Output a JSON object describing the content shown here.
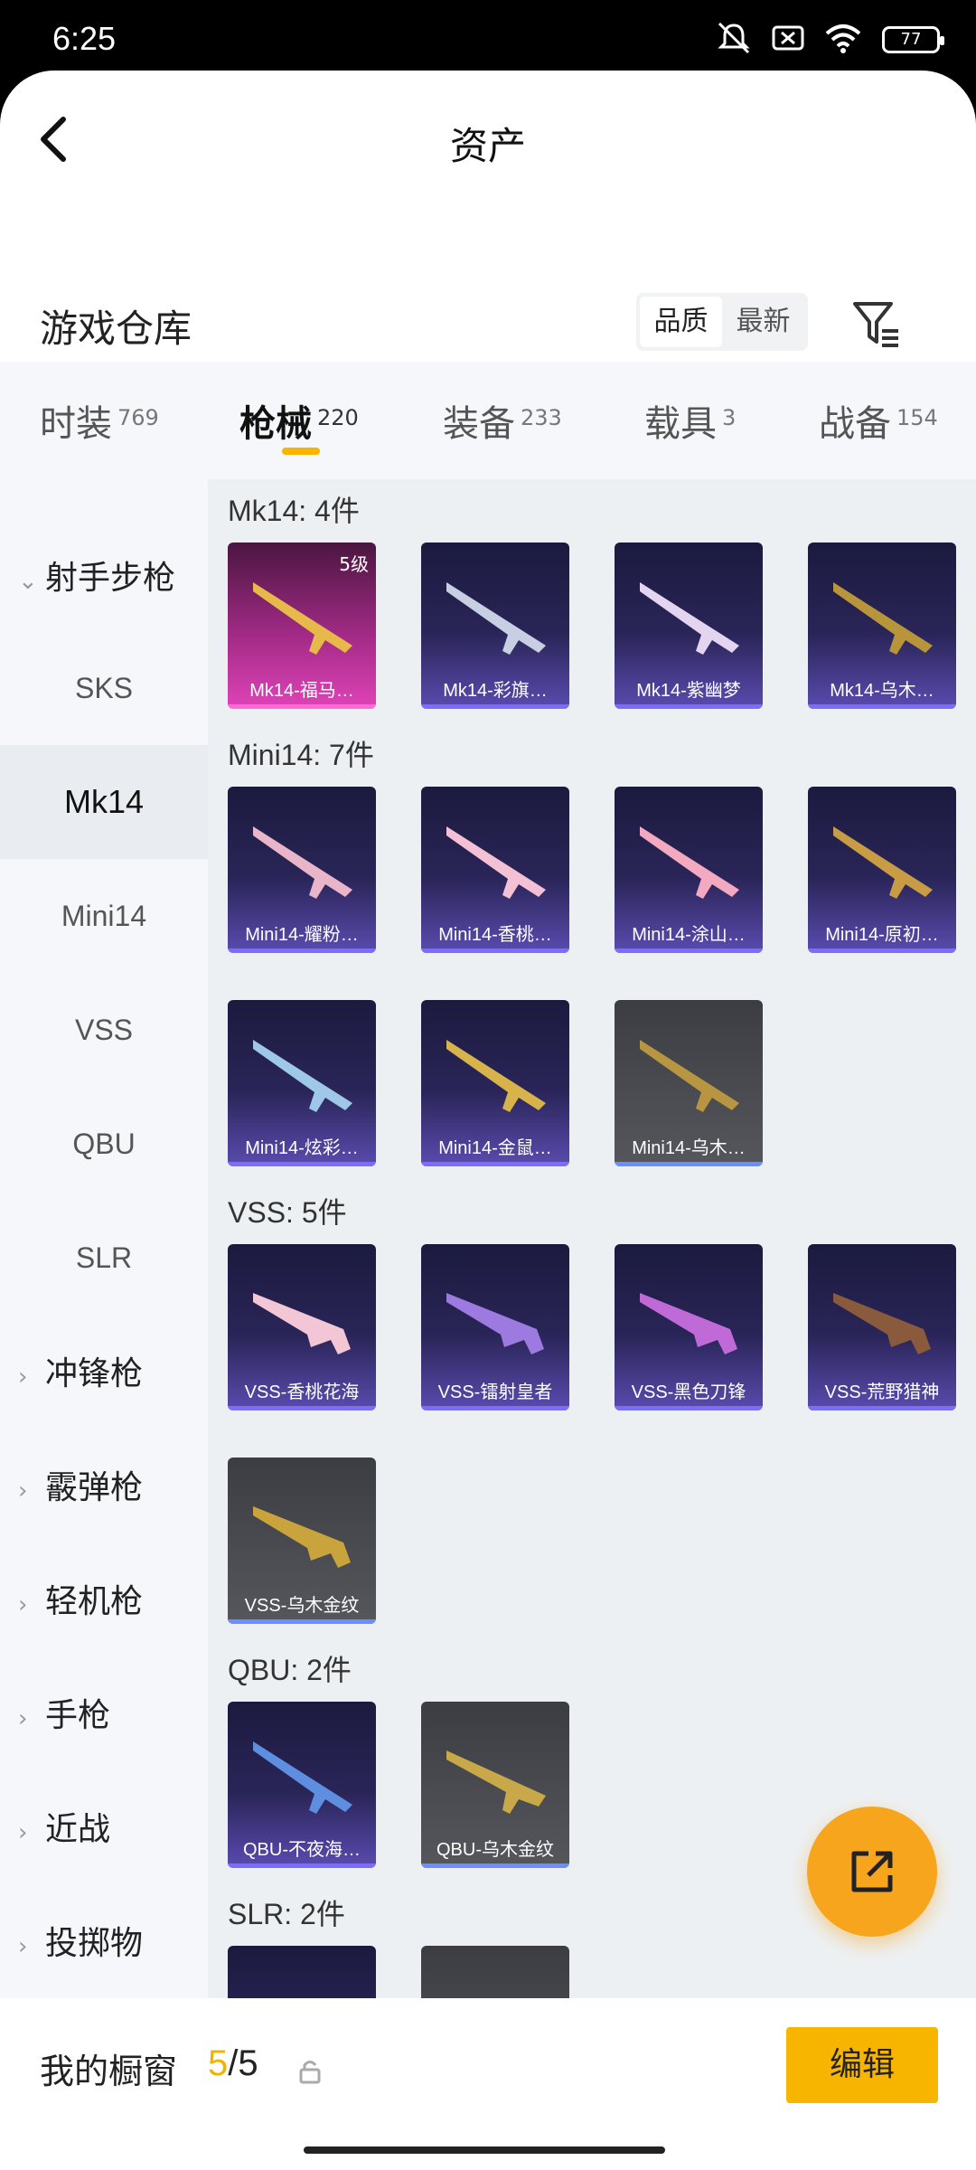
{
  "status": {
    "time": "6:25",
    "battery": "77"
  },
  "nav": {
    "title": "资产"
  },
  "warehouse": {
    "title": "游戏仓库",
    "sort_quality": "品质",
    "sort_newest": "最新"
  },
  "tabs": [
    {
      "label": "时装",
      "count": "769"
    },
    {
      "label": "枪械",
      "count": "220"
    },
    {
      "label": "装备",
      "count": "233"
    },
    {
      "label": "载具",
      "count": "3"
    },
    {
      "label": "战备",
      "count": "154"
    }
  ],
  "sidebar": {
    "group_sniper": "射手步枪",
    "items": [
      "SKS",
      "Mk14",
      "Mini14",
      "VSS",
      "QBU",
      "SLR"
    ],
    "groups": [
      "冲锋枪",
      "霰弹枪",
      "轻机枪",
      "手枪",
      "近战",
      "投掷物"
    ]
  },
  "sections": [
    {
      "title": "Mk14: 4件",
      "items": [
        "Mk14-福马…",
        "Mk14-彩旗…",
        "Mk14-紫幽梦",
        "Mk14-乌木…"
      ],
      "level": "5级"
    },
    {
      "title": "Mini14: 7件",
      "items": [
        "Mini14-耀粉…",
        "Mini14-香桃…",
        "Mini14-涂山…",
        "Mini14-原初…",
        "Mini14-炫彩…",
        "Mini14-金鼠…",
        "Mini14-乌木…"
      ]
    },
    {
      "title": "VSS: 5件",
      "items": [
        "VSS-香桃花海",
        "VSS-镭射皇者",
        "VSS-黑色刀锋",
        "VSS-荒野猎神",
        "VSS-乌木金纹"
      ]
    },
    {
      "title": "QBU: 2件",
      "items": [
        "QBU-不夜海…",
        "QBU-乌木金纹"
      ]
    },
    {
      "title": "SLR: 2件"
    }
  ],
  "bottom": {
    "showcase_label": "我的橱窗",
    "current": "5",
    "total": "/5",
    "edit": "编辑"
  },
  "colors": {
    "accent": "#f7b500",
    "fab": "#f7a51c"
  }
}
